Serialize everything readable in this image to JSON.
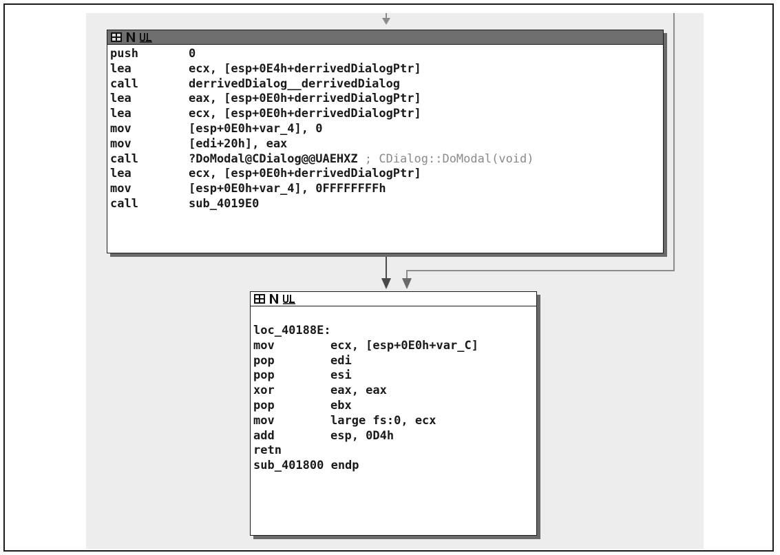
{
  "node_top": {
    "active": true,
    "icons": [
      "graph-icon",
      "note-icon",
      "xref-icon"
    ],
    "lines": [
      {
        "mnemonic": "push",
        "operand": "0",
        "comment": ""
      },
      {
        "mnemonic": "lea",
        "operand": "ecx, [esp+0E4h+derrivedDialogPtr]",
        "comment": ""
      },
      {
        "mnemonic": "call",
        "operand": "derrivedDialog__derrivedDialog",
        "comment": ""
      },
      {
        "mnemonic": "lea",
        "operand": "eax, [esp+0E0h+derrivedDialogPtr]",
        "comment": ""
      },
      {
        "mnemonic": "lea",
        "operand": "ecx, [esp+0E0h+derrivedDialogPtr]",
        "comment": ""
      },
      {
        "mnemonic": "mov",
        "operand": "[esp+0E0h+var_4], 0",
        "comment": ""
      },
      {
        "mnemonic": "mov",
        "operand": "[edi+20h], eax",
        "comment": ""
      },
      {
        "mnemonic": "call",
        "operand": "?DoModal@CDialog@@UAEHXZ",
        "comment": " ; CDialog::DoModal(void)"
      },
      {
        "mnemonic": "lea",
        "operand": "ecx, [esp+0E0h+derrivedDialogPtr]",
        "comment": ""
      },
      {
        "mnemonic": "mov",
        "operand": "[esp+0E0h+var_4], 0FFFFFFFFh",
        "comment": ""
      },
      {
        "mnemonic": "call",
        "operand": "sub_4019E0",
        "comment": ""
      }
    ]
  },
  "node_bottom": {
    "active": false,
    "icons": [
      "graph-icon",
      "note-icon",
      "xref-icon"
    ],
    "label": "loc_40188E:",
    "lines": [
      {
        "mnemonic": "mov",
        "operand": "ecx, [esp+0E0h+var_C]"
      },
      {
        "mnemonic": "pop",
        "operand": "edi"
      },
      {
        "mnemonic": "pop",
        "operand": "esi"
      },
      {
        "mnemonic": "xor",
        "operand": "eax, eax"
      },
      {
        "mnemonic": "pop",
        "operand": "ebx"
      },
      {
        "mnemonic": "mov",
        "operand": "large fs:0, ecx"
      },
      {
        "mnemonic": "add",
        "operand": "esp, 0D4h"
      },
      {
        "mnemonic": "retn",
        "operand": ""
      }
    ],
    "footer": "sub_401800 endp"
  },
  "colors": {
    "canvas": "#ededed",
    "text": "#1a1a1a",
    "comment": "#8a8a8a",
    "active_header": "#6f6f6f",
    "edge": "#4a4a4a",
    "edge_light": "#8c8c8c"
  }
}
